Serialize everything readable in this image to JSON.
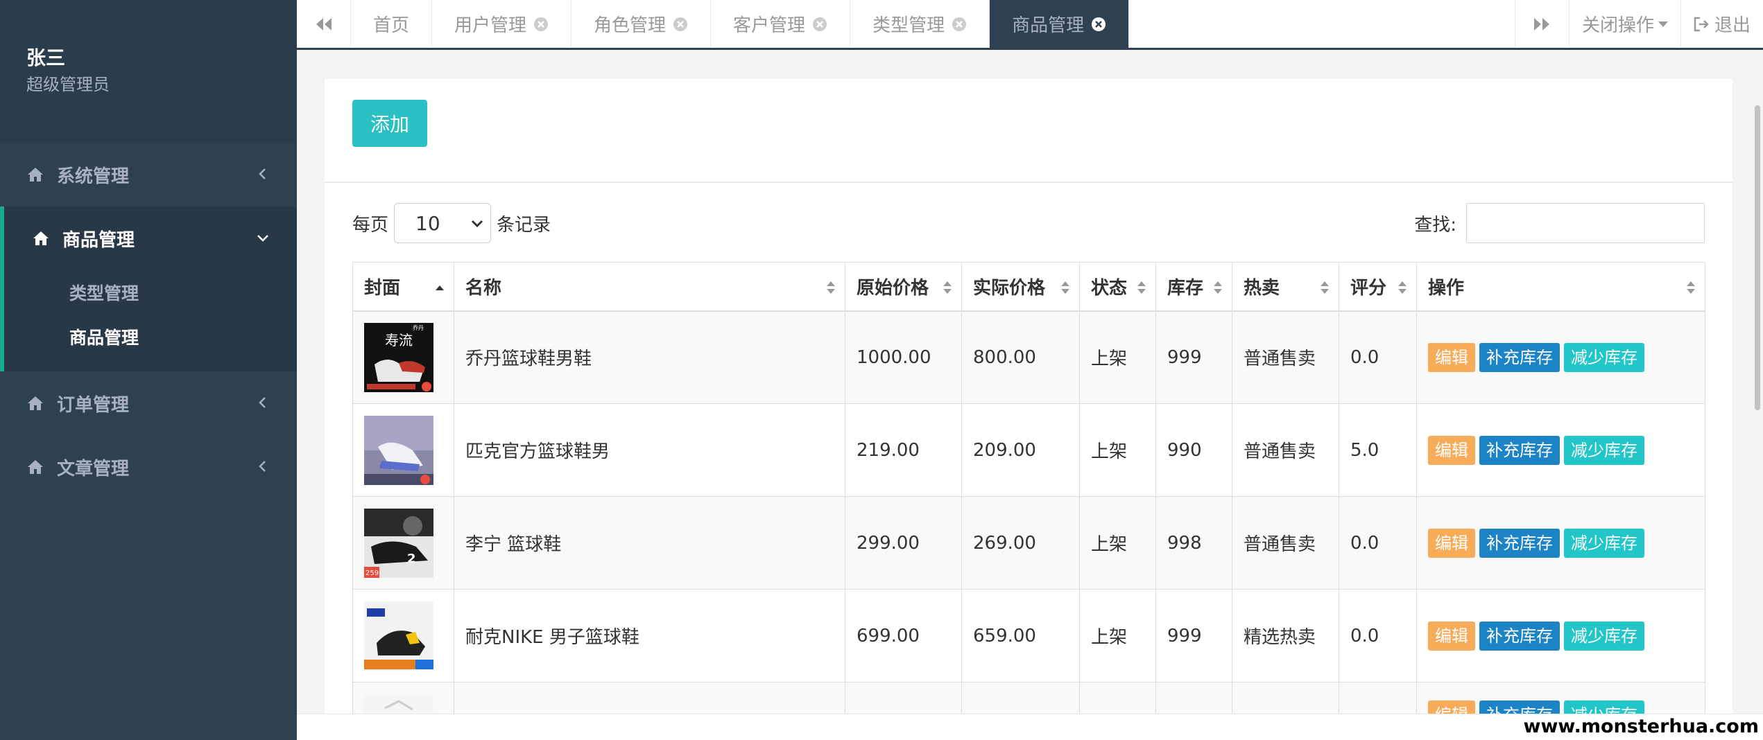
{
  "user": {
    "name": "张三",
    "role": "超级管理员"
  },
  "menu": [
    {
      "label": "系统管理",
      "expanded": false
    },
    {
      "label": "商品管理",
      "expanded": true,
      "children": [
        "类型管理",
        "商品管理"
      ],
      "current": "商品管理"
    },
    {
      "label": "订单管理",
      "expanded": false
    },
    {
      "label": "文章管理",
      "expanded": false
    }
  ],
  "tabs": [
    {
      "label": "首页",
      "closable": false
    },
    {
      "label": "用户管理",
      "closable": true
    },
    {
      "label": "角色管理",
      "closable": true
    },
    {
      "label": "客户管理",
      "closable": true
    },
    {
      "label": "类型管理",
      "closable": true
    },
    {
      "label": "商品管理",
      "closable": true,
      "active": true
    }
  ],
  "tabbar": {
    "close_ops": "关闭操作",
    "logout": "退出"
  },
  "toolbar": {
    "add_label": "添加",
    "per_page_prefix": "每页",
    "per_page_value": "10",
    "per_page_suffix": "条记录",
    "search_label": "查找:"
  },
  "table": {
    "columns": [
      "封面",
      "名称",
      "原始价格",
      "实际价格",
      "状态",
      "库存",
      "热卖",
      "评分",
      "操作"
    ],
    "rows": [
      {
        "name": "乔丹篮球鞋男鞋",
        "original_price": "1000.00",
        "actual_price": "800.00",
        "status": "上架",
        "stock": "999",
        "hot": "普通售卖",
        "rating": "0.0",
        "cover_text": "寿流",
        "cover_tag": "乔丹"
      },
      {
        "name": "匹克官方篮球鞋男",
        "original_price": "219.00",
        "actual_price": "209.00",
        "status": "上架",
        "stock": "990",
        "hot": "普通售卖",
        "rating": "5.0",
        "cover_text": "",
        "cover_tag": ""
      },
      {
        "name": "李宁 篮球鞋",
        "original_price": "299.00",
        "actual_price": "269.00",
        "status": "上架",
        "stock": "998",
        "hot": "普通售卖",
        "rating": "0.0",
        "cover_text": "2",
        "cover_tag": "259"
      },
      {
        "name": "耐克NIKE 男子篮球鞋",
        "original_price": "699.00",
        "actual_price": "659.00",
        "status": "上架",
        "stock": "999",
        "hot": "精选热卖",
        "rating": "0.0",
        "cover_text": "",
        "cover_tag": ""
      }
    ],
    "actions": {
      "edit": "编辑",
      "add_stock": "补充库存",
      "reduce_stock": "减少库存"
    }
  },
  "watermark": "www.monsterhua.com",
  "colors": {
    "sidebar": "#2f4050",
    "add_button": "#2bc0c4",
    "edit": "#f8ac59",
    "add_stock": "#1c84c6",
    "reduce_stock": "#23c6c8"
  }
}
